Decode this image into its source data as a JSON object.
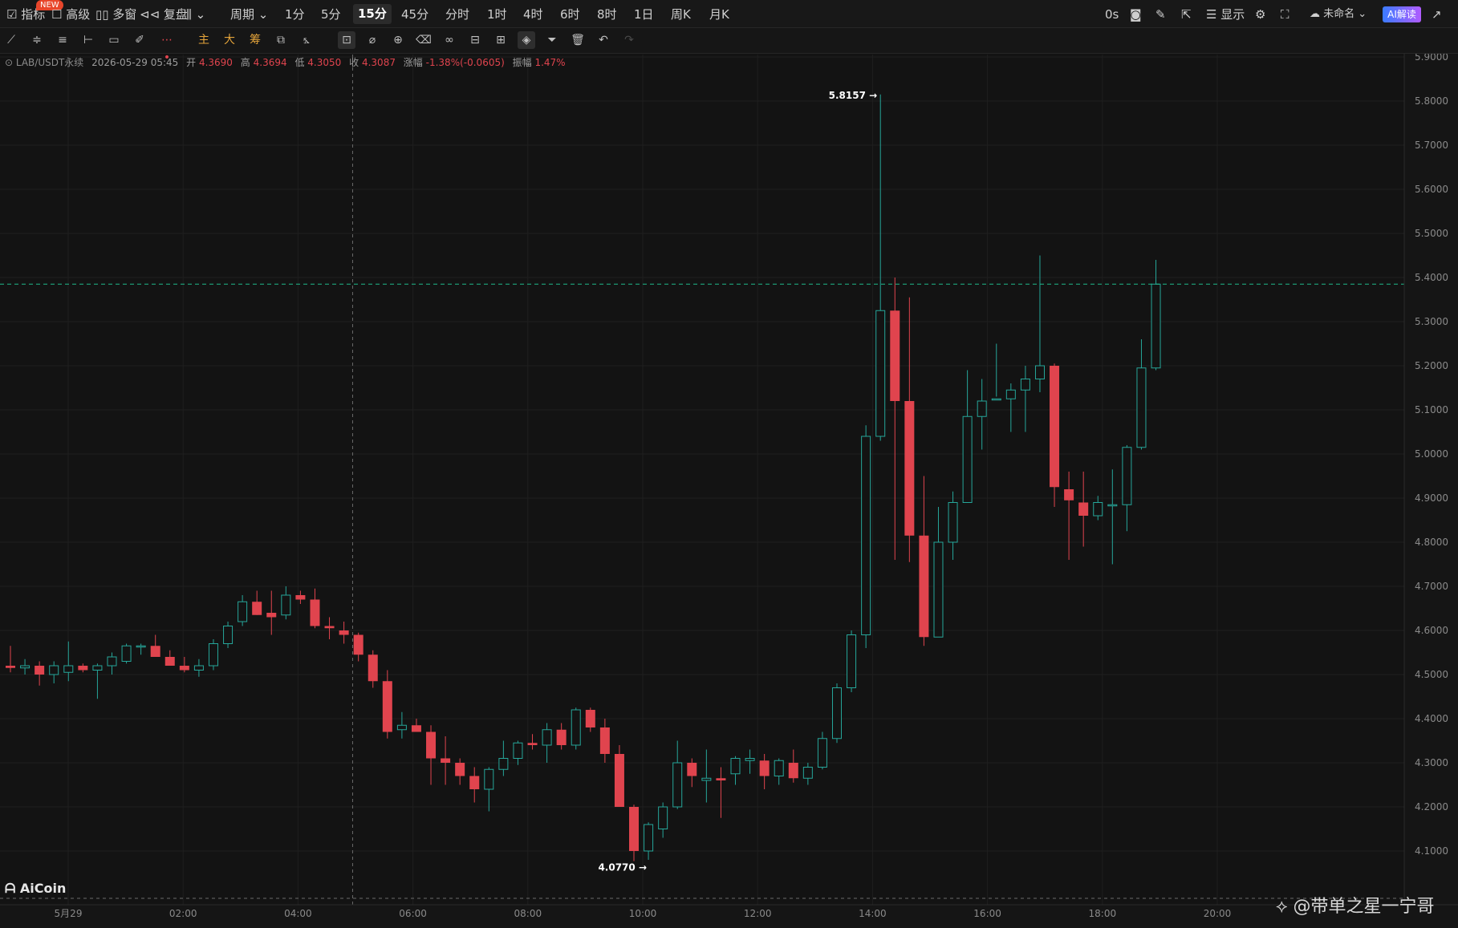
{
  "topbar": {
    "indicator": "指标",
    "new_badge": "NEW",
    "advanced": "高级",
    "multi_window": "多窗",
    "replay": "复盘",
    "period": "周期",
    "periods": [
      "1分",
      "5分",
      "15分",
      "45分",
      "分时",
      "1时",
      "4时",
      "6时",
      "8时",
      "1日",
      "周K",
      "月K"
    ],
    "active_period": "15分",
    "countdown": "0s",
    "display": "显示",
    "unnamed": "未命名",
    "ai_read": "AI解读"
  },
  "toolbar": {
    "main": "主",
    "big": "大",
    "chip": "筹"
  },
  "info": {
    "symbol": "LAB/USDT永续",
    "datetime": "2026-05-29 05:45",
    "open_label": "开",
    "open": "4.3690",
    "high_label": "高",
    "high": "4.3694",
    "low_label": "低",
    "low": "4.3050",
    "close_label": "收",
    "close": "4.3087",
    "change_label": "涨幅",
    "change": "-1.38%(-0.0605)",
    "amp_label": "振幅",
    "amp": "1.47%"
  },
  "logo": "AiCoin",
  "watermark": "@带单之星一宁哥",
  "colors": {
    "up": "#26a69a",
    "down": "#e0444e",
    "bg": "#131313",
    "price_tag": "#1fb98a"
  },
  "chart_data": {
    "type": "candlestick",
    "interval": "15分",
    "ylim": [
      4.06,
      5.93
    ],
    "y_ticks": [
      4.1,
      4.2,
      4.3,
      4.4,
      4.5,
      4.6,
      4.7,
      4.8,
      4.9,
      5.0,
      5.1,
      5.2,
      5.3,
      5.4,
      5.5,
      5.6,
      5.7,
      5.8,
      5.9
    ],
    "x_ticks": [
      "5月29",
      "02:00",
      "04:00",
      "06:00",
      "08:00",
      "10:00",
      "12:00",
      "14:00",
      "16:00",
      "18:00",
      "20:00"
    ],
    "crosshair_time": "2026-05-29 05:45",
    "current_price": "5.3851",
    "max_label": "5.8157",
    "min_label": "4.0770",
    "candles": [
      [
        4.52,
        4.565,
        4.505,
        4.515
      ],
      [
        4.515,
        4.535,
        4.5,
        4.52
      ],
      [
        4.52,
        4.53,
        4.475,
        4.5
      ],
      [
        4.5,
        4.53,
        4.48,
        4.52
      ],
      [
        4.505,
        4.575,
        4.485,
        4.52
      ],
      [
        4.52,
        4.525,
        4.505,
        4.51
      ],
      [
        4.51,
        4.525,
        4.445,
        4.52
      ],
      [
        4.52,
        4.55,
        4.5,
        4.54
      ],
      [
        4.53,
        4.57,
        4.525,
        4.565
      ],
      [
        4.565,
        4.57,
        4.545,
        4.565
      ],
      [
        4.565,
        4.59,
        4.54,
        4.54
      ],
      [
        4.54,
        4.555,
        4.52,
        4.52
      ],
      [
        4.52,
        4.54,
        4.505,
        4.51
      ],
      [
        4.51,
        4.535,
        4.495,
        4.52
      ],
      [
        4.52,
        4.58,
        4.51,
        4.57
      ],
      [
        4.57,
        4.62,
        4.56,
        4.61
      ],
      [
        4.62,
        4.68,
        4.61,
        4.665
      ],
      [
        4.665,
        4.69,
        4.635,
        4.635
      ],
      [
        4.64,
        4.69,
        4.59,
        4.63
      ],
      [
        4.635,
        4.7,
        4.625,
        4.68
      ],
      [
        4.68,
        4.69,
        4.66,
        4.67
      ],
      [
        4.67,
        4.695,
        4.605,
        4.61
      ],
      [
        4.61,
        4.63,
        4.58,
        4.605
      ],
      [
        4.6,
        4.62,
        4.57,
        4.59
      ],
      [
        4.59,
        4.595,
        4.53,
        4.545
      ],
      [
        4.545,
        4.555,
        4.47,
        4.485
      ],
      [
        4.485,
        4.51,
        4.355,
        4.37
      ],
      [
        4.375,
        4.415,
        4.355,
        4.385
      ],
      [
        4.385,
        4.4,
        4.37,
        4.37
      ],
      [
        4.37,
        4.385,
        4.25,
        4.31
      ],
      [
        4.31,
        4.36,
        4.25,
        4.3
      ],
      [
        4.3,
        4.31,
        4.25,
        4.27
      ],
      [
        4.27,
        4.29,
        4.21,
        4.24
      ],
      [
        4.24,
        4.29,
        4.19,
        4.285
      ],
      [
        4.285,
        4.35,
        4.27,
        4.31
      ],
      [
        4.31,
        4.35,
        4.295,
        4.345
      ],
      [
        4.345,
        4.365,
        4.33,
        4.34
      ],
      [
        4.34,
        4.39,
        4.3,
        4.375
      ],
      [
        4.375,
        4.39,
        4.33,
        4.34
      ],
      [
        4.34,
        4.425,
        4.33,
        4.42
      ],
      [
        4.42,
        4.425,
        4.37,
        4.38
      ],
      [
        4.38,
        4.4,
        4.3,
        4.32
      ],
      [
        4.32,
        4.34,
        4.2,
        4.2
      ],
      [
        4.2,
        4.205,
        4.077,
        4.1
      ],
      [
        4.1,
        4.165,
        4.08,
        4.16
      ],
      [
        4.15,
        4.21,
        4.13,
        4.2
      ],
      [
        4.2,
        4.35,
        4.195,
        4.3
      ],
      [
        4.3,
        4.31,
        4.245,
        4.27
      ],
      [
        4.26,
        4.33,
        4.21,
        4.265
      ],
      [
        4.265,
        4.29,
        4.175,
        4.26
      ],
      [
        4.275,
        4.315,
        4.25,
        4.31
      ],
      [
        4.305,
        4.33,
        4.275,
        4.31
      ],
      [
        4.305,
        4.32,
        4.24,
        4.27
      ],
      [
        4.27,
        4.31,
        4.25,
        4.305
      ],
      [
        4.3,
        4.33,
        4.255,
        4.265
      ],
      [
        4.265,
        4.3,
        4.25,
        4.29
      ],
      [
        4.29,
        4.37,
        4.285,
        4.355
      ],
      [
        4.355,
        4.48,
        4.345,
        4.47
      ],
      [
        4.47,
        4.6,
        4.46,
        4.59
      ],
      [
        4.59,
        5.065,
        4.56,
        5.04
      ],
      [
        5.04,
        5.815,
        5.03,
        5.325
      ],
      [
        5.325,
        5.4,
        4.76,
        5.12
      ],
      [
        5.12,
        5.355,
        4.755,
        4.815
      ],
      [
        4.815,
        4.95,
        4.565,
        4.585
      ],
      [
        4.585,
        4.88,
        4.585,
        4.8
      ],
      [
        4.8,
        4.915,
        4.76,
        4.89
      ],
      [
        4.89,
        5.19,
        4.89,
        5.085
      ],
      [
        5.085,
        5.17,
        5.01,
        5.12
      ],
      [
        5.125,
        5.25,
        5.13,
        5.125
      ],
      [
        5.125,
        5.16,
        5.05,
        5.145
      ],
      [
        5.145,
        5.2,
        5.05,
        5.17
      ],
      [
        5.17,
        5.45,
        5.14,
        5.2
      ],
      [
        5.2,
        5.205,
        4.88,
        4.925
      ],
      [
        4.92,
        4.96,
        4.76,
        4.895
      ],
      [
        4.89,
        4.96,
        4.79,
        4.86
      ],
      [
        4.86,
        4.905,
        4.85,
        4.89
      ],
      [
        4.885,
        4.965,
        4.75,
        4.885
      ],
      [
        4.885,
        5.02,
        4.825,
        5.015
      ],
      [
        5.015,
        5.26,
        5.01,
        5.195
      ],
      [
        5.195,
        5.44,
        5.19,
        5.385
      ]
    ]
  }
}
